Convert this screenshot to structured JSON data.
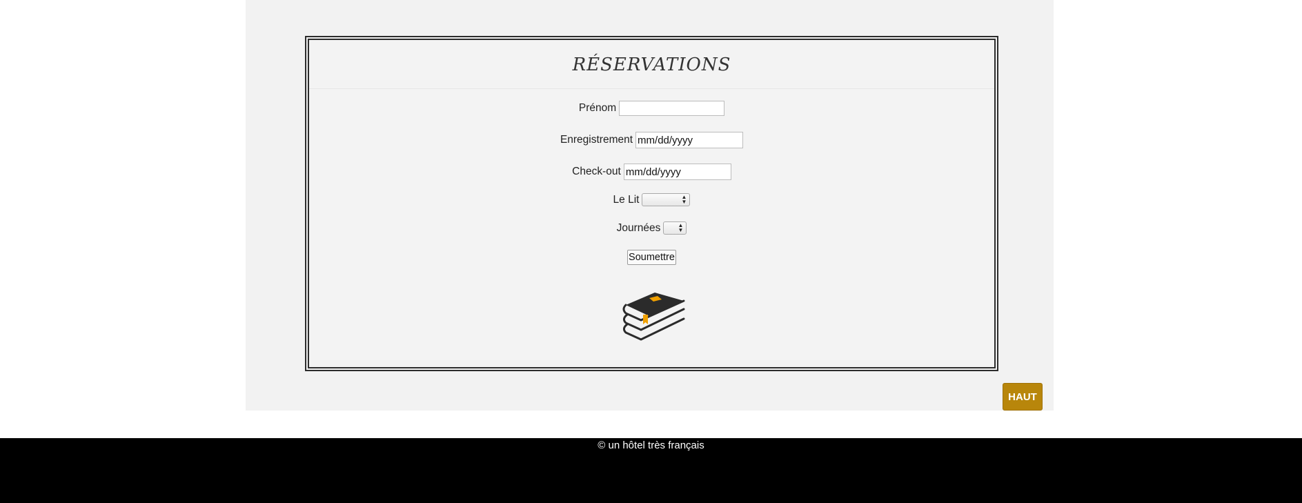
{
  "reservation": {
    "title": "RÉSERVATIONS",
    "fields": {
      "prenom_label": "Prénom",
      "prenom_value": "",
      "enregistrement_label": "Enregistrement",
      "enregistrement_value": "mm/dd/yyyy",
      "checkout_label": "Check-out",
      "checkout_value": "mm/dd/yyyy",
      "lit_label": "Le Lit",
      "lit_value": "",
      "journees_label": "Journées",
      "journees_value": ""
    },
    "submit_label": "Soumettre",
    "icon": "books-stack-icon"
  },
  "haut_button": "HAUT",
  "footer": {
    "text": "© un hôtel très français"
  },
  "colors": {
    "accent": "#b8860b",
    "bookmark": "#f0a000",
    "page_bg": "#f2f2f2",
    "footer_bg": "#000000"
  }
}
